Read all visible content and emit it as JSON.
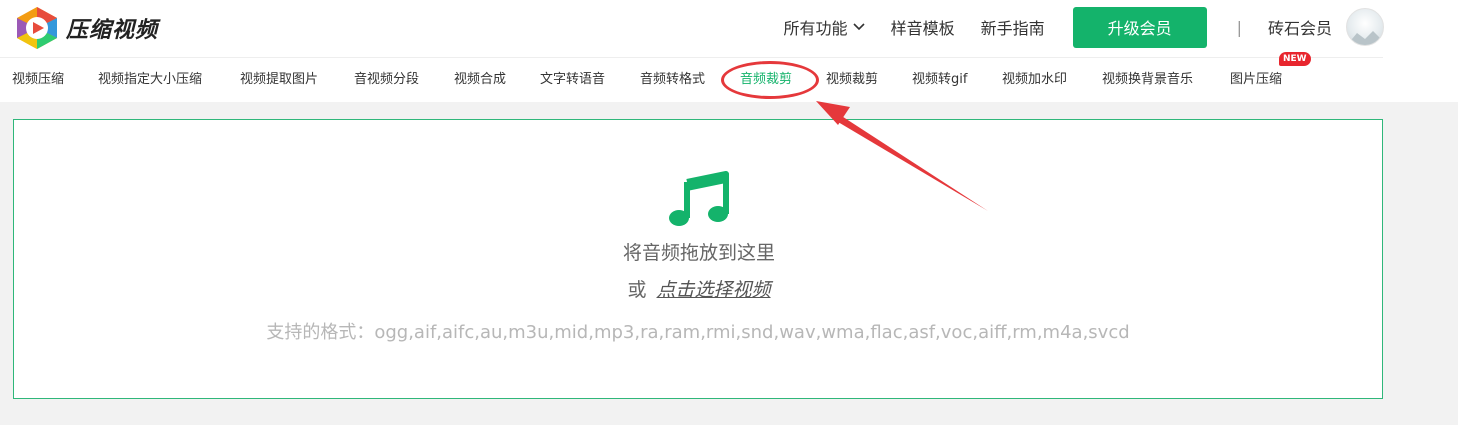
{
  "header": {
    "logo_text": "压缩视频",
    "nav": {
      "all_features": "所有功能",
      "audio_templates": "样音模板",
      "beginner_guide": "新手指南"
    },
    "upgrade_button": "升级会员",
    "separator": "|",
    "membership_label": "砖石会员"
  },
  "tools": [
    {
      "label": "视频压缩"
    },
    {
      "label": "视频指定大小压缩"
    },
    {
      "label": "视频提取图片"
    },
    {
      "label": "音视频分段"
    },
    {
      "label": "视频合成"
    },
    {
      "label": "文字转语音"
    },
    {
      "label": "音频转格式"
    },
    {
      "label": "音频裁剪",
      "active": true
    },
    {
      "label": "视频裁剪"
    },
    {
      "label": "视频转gif"
    },
    {
      "label": "视频加水印"
    },
    {
      "label": "视频换背景音乐"
    },
    {
      "label": "图片压缩",
      "badge": "NEW"
    }
  ],
  "upload": {
    "icon": "music-note-icon",
    "drop_text": "将音频拖放到这里",
    "or_text": "或",
    "select_text": "点击选择视频",
    "formats_text": "支持的格式：ogg,aif,aifc,au,m3u,mid,mp3,ra,ram,rmi,snd,wav,wma,flac,asf,voc,aiff,rm,m4a,svcd"
  },
  "colors": {
    "accent": "#14b36b",
    "annotation": "#e5383b",
    "badge": "#e8262e"
  }
}
